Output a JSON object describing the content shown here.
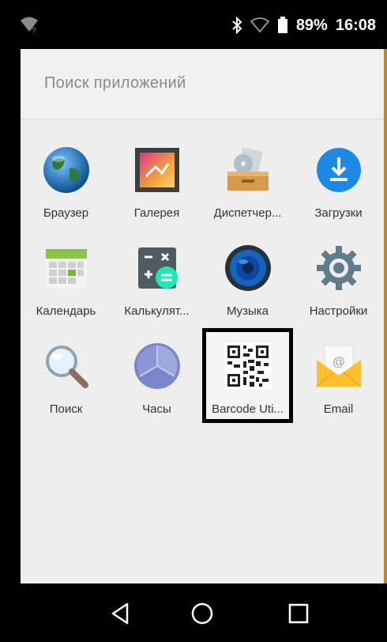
{
  "status": {
    "battery": "89%",
    "time": "16:08"
  },
  "search": {
    "placeholder": "Поиск приложений"
  },
  "apps": [
    {
      "label": "Браузер",
      "icon": "browser-globe-icon"
    },
    {
      "label": "Галерея",
      "icon": "gallery-icon"
    },
    {
      "label": "Диспетчер...",
      "icon": "file-manager-icon"
    },
    {
      "label": "Загрузки",
      "icon": "downloads-icon"
    },
    {
      "label": "Календарь",
      "icon": "calendar-icon"
    },
    {
      "label": "Калькулят...",
      "icon": "calculator-icon"
    },
    {
      "label": "Музыка",
      "icon": "music-speaker-icon"
    },
    {
      "label": "Настройки",
      "icon": "settings-gear-icon"
    },
    {
      "label": "Поиск",
      "icon": "search-magnifier-icon"
    },
    {
      "label": "Часы",
      "icon": "clock-icon"
    },
    {
      "label": "Barcode Uti...",
      "icon": "qr-code-icon",
      "selected": true
    },
    {
      "label": "Email",
      "icon": "email-envelope-icon"
    }
  ],
  "navbar": {
    "back": "back-triangle-icon",
    "home": "home-circle-icon",
    "recents": "recents-square-icon"
  }
}
